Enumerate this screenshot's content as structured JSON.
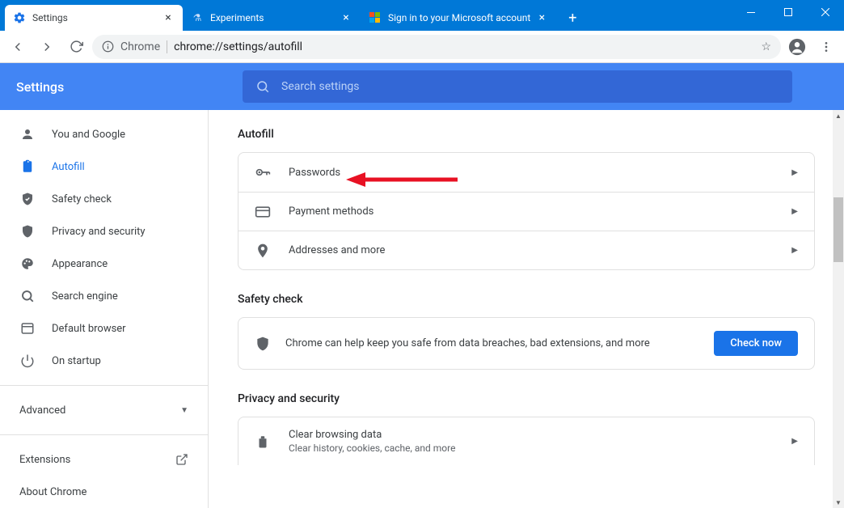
{
  "window": {
    "tabs": [
      {
        "title": "Settings",
        "active": true
      },
      {
        "title": "Experiments",
        "active": false
      },
      {
        "title": "Sign in to your Microsoft account",
        "active": false
      }
    ]
  },
  "toolbar": {
    "chrome_label": "Chrome",
    "url": "chrome://settings/autofill"
  },
  "header": {
    "title": "Settings",
    "search_placeholder": "Search settings"
  },
  "sidebar": {
    "items": [
      {
        "label": "You and Google",
        "icon": "person"
      },
      {
        "label": "Autofill",
        "icon": "clipboard",
        "active": true
      },
      {
        "label": "Safety check",
        "icon": "shield-check"
      },
      {
        "label": "Privacy and security",
        "icon": "shield"
      },
      {
        "label": "Appearance",
        "icon": "palette"
      },
      {
        "label": "Search engine",
        "icon": "search"
      },
      {
        "label": "Default browser",
        "icon": "browser"
      },
      {
        "label": "On startup",
        "icon": "power"
      }
    ],
    "advanced_label": "Advanced",
    "extensions_label": "Extensions",
    "about_label": "About Chrome"
  },
  "content": {
    "autofill": {
      "title": "Autofill",
      "rows": [
        {
          "label": "Passwords",
          "icon": "key"
        },
        {
          "label": "Payment methods",
          "icon": "card"
        },
        {
          "label": "Addresses and more",
          "icon": "pin"
        }
      ]
    },
    "safety": {
      "title": "Safety check",
      "desc": "Chrome can help keep you safe from data breaches, bad extensions, and more",
      "button": "Check now"
    },
    "privacy": {
      "title": "Privacy and security",
      "row_title": "Clear browsing data",
      "row_sub": "Clear history, cookies, cache, and more"
    }
  }
}
